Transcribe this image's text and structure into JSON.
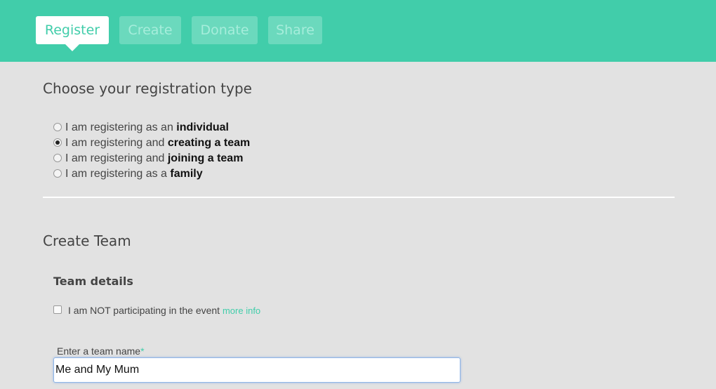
{
  "tabs": [
    {
      "label": "Register",
      "active": true
    },
    {
      "label": "Create",
      "active": false
    },
    {
      "label": "Donate",
      "active": false
    },
    {
      "label": "Share",
      "active": false
    }
  ],
  "registration": {
    "title": "Choose your registration type",
    "options": [
      {
        "prefix": "I am registering as an ",
        "bold": "individual",
        "checked": false
      },
      {
        "prefix": "I am registering and ",
        "bold": "creating a team",
        "checked": true
      },
      {
        "prefix": "I am registering and ",
        "bold": "joining a team",
        "checked": false
      },
      {
        "prefix": "I am registering as a ",
        "bold": "family",
        "checked": false
      }
    ]
  },
  "create_team": {
    "title": "Create Team",
    "subtitle": "Team details",
    "not_participating_label": "I am NOT participating in the event",
    "not_participating_checked": false,
    "more_info_link": "more info",
    "team_name_label": "Enter a team name",
    "required_marker": "*",
    "team_name_value": "Me and My Mum"
  },
  "colors": {
    "accent": "#41cdaa",
    "background": "#e2e2e2"
  }
}
